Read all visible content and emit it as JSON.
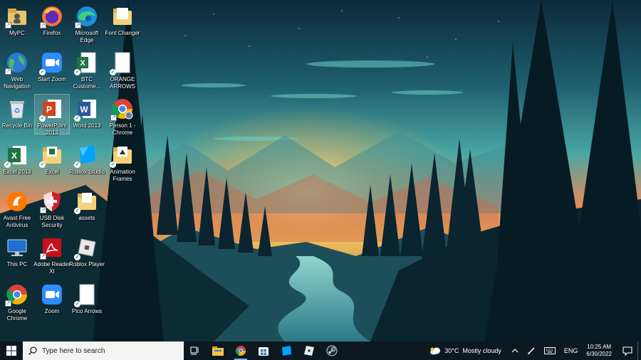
{
  "desktop_icons": [
    {
      "label": "MyPC",
      "icon": "folder-user-icon"
    },
    {
      "label": "Firefox",
      "icon": "firefox-icon"
    },
    {
      "label": "Microsoft Edge",
      "icon": "edge-icon"
    },
    {
      "label": "Font Changer",
      "icon": "folder-icon"
    },
    {
      "label": "Web Navigation",
      "icon": "globe-icon"
    },
    {
      "label": "Start Zoom",
      "icon": "zoom-icon"
    },
    {
      "label": "BTC Custome...",
      "icon": "excel-file-icon"
    },
    {
      "label": "ORANGE ARROWS",
      "icon": "blank-file-icon"
    },
    {
      "label": "Recycle Bin",
      "icon": "recycle-bin-icon"
    },
    {
      "label": "PowerPoint 2013",
      "icon": "powerpoint-icon"
    },
    {
      "label": "Word 2013",
      "icon": "word-icon"
    },
    {
      "label": "Person 1 - Chrome",
      "icon": "chrome-profile-icon"
    },
    {
      "label": "Excel 2013",
      "icon": "excel-icon"
    },
    {
      "label": "Excel",
      "icon": "folder-icon"
    },
    {
      "label": "Roblox Studio",
      "icon": "roblox-studio-icon"
    },
    {
      "label": "Animation Frames",
      "icon": "folder-icon"
    },
    {
      "label": "Avast Free Antivirus",
      "icon": "avast-icon"
    },
    {
      "label": "USB Disk Security",
      "icon": "shield-icon"
    },
    {
      "label": "assets",
      "icon": "folder-icon"
    },
    {
      "label": "This PC",
      "icon": "computer-icon"
    },
    {
      "label": "Adobe Reader XI",
      "icon": "pdf-icon"
    },
    {
      "label": "Roblox Player",
      "icon": "roblox-icon"
    },
    {
      "label": "Google Chrome",
      "icon": "chrome-icon"
    },
    {
      "label": "Zoom",
      "icon": "zoom-icon"
    },
    {
      "label": "Pico Arrows",
      "icon": "blank-file-icon"
    }
  ],
  "taskbar": {
    "search_placeholder": "Type here to search",
    "weather_temp": "30°C",
    "weather_text": "Mostly cloudy",
    "language": "ENG",
    "time": "10:25 AM",
    "date": "6/30/2022"
  },
  "colors": {
    "taskbar": "#0e1821",
    "accent": "#76b9ed"
  }
}
